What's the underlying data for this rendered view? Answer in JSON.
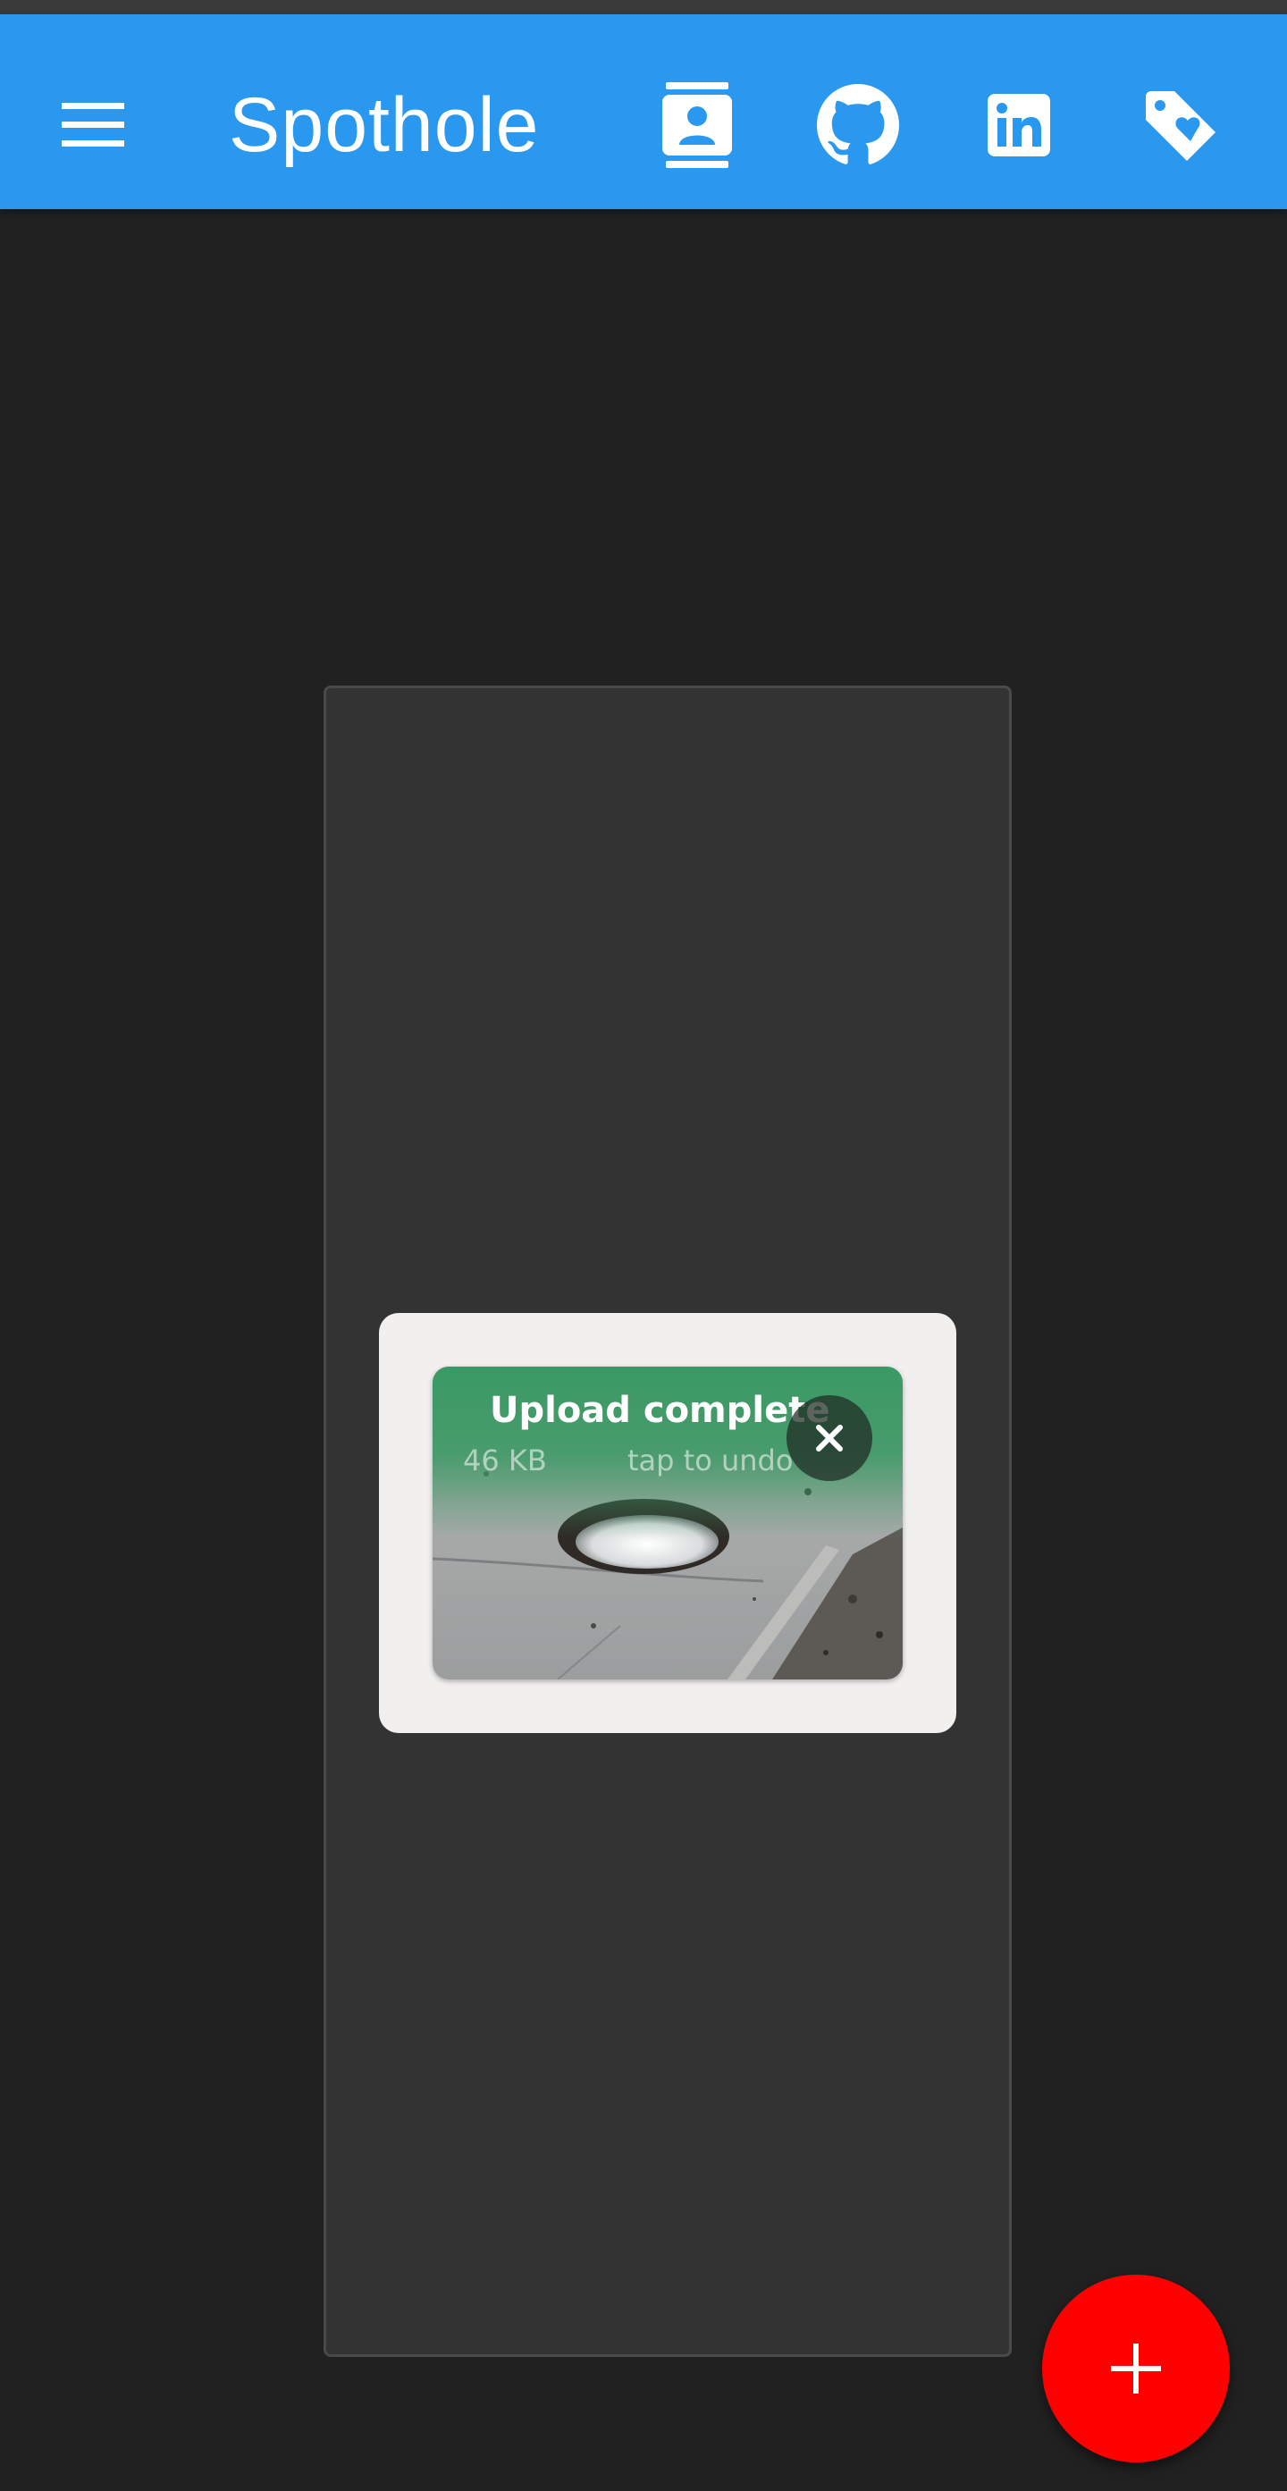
{
  "app": {
    "title": "Spothole"
  },
  "toolbar": {
    "menu_icon": "menu-icon",
    "actions": [
      {
        "name": "contacts",
        "icon": "contact-card-icon"
      },
      {
        "name": "github",
        "icon": "github-icon"
      },
      {
        "name": "linkedin",
        "icon": "linkedin-icon"
      },
      {
        "name": "donate",
        "icon": "tag-heart-icon"
      }
    ]
  },
  "upload": {
    "status": "Upload complete",
    "size": "46 KB",
    "hint": "tap to undo",
    "close_icon": "close-icon"
  },
  "fab": {
    "icon": "plus-icon"
  },
  "colors": {
    "appbar": "#2b98f0",
    "background": "#212121",
    "panel": "#333333",
    "card": "#f1f0ef",
    "upload_success": "#3a9a64",
    "fab": "#ff0000"
  }
}
